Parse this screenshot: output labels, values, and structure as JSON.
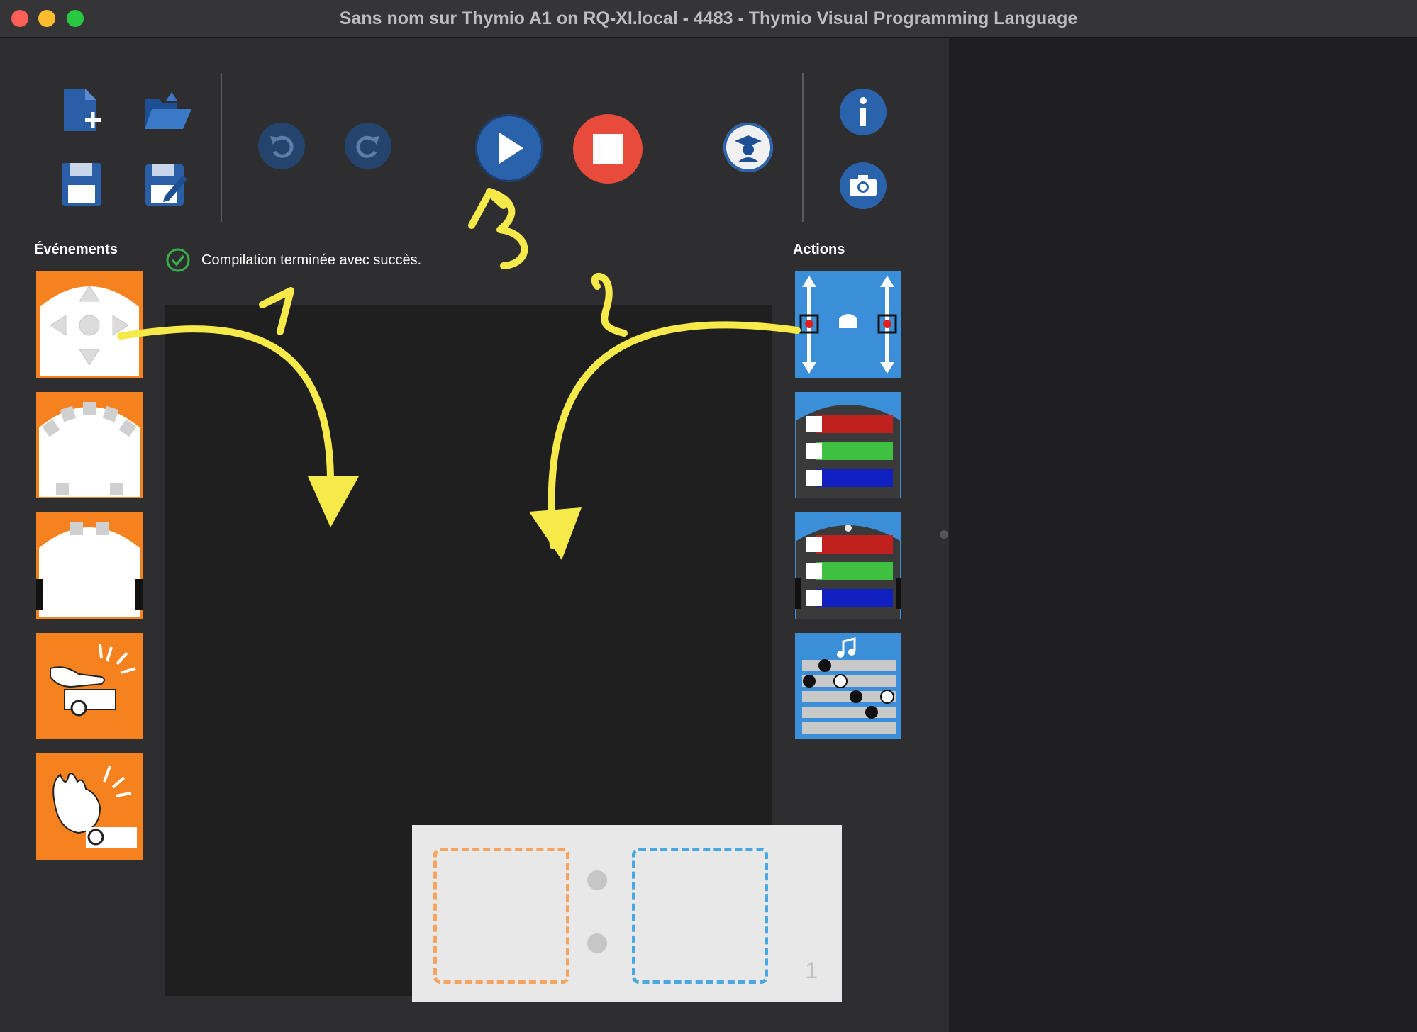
{
  "window": {
    "title": "Sans nom  sur Thymio A1 on RQ-XI.local - 4483 - Thymio Visual Programming Language"
  },
  "toolbar": {
    "new_icon": "new-file-icon",
    "open_icon": "open-folder-icon",
    "save_icon": "save-icon",
    "save_as_icon": "save-as-icon",
    "undo_icon": "undo-icon",
    "redo_icon": "redo-icon",
    "run_icon": "play-icon",
    "stop_icon": "stop-icon",
    "advanced_icon": "graduate-icon",
    "info_icon": "info-icon",
    "screenshot_icon": "camera-icon"
  },
  "events_label": "Événements",
  "actions_label": "Actions",
  "status": {
    "message": "Compilation terminée avec succès."
  },
  "event_blocks": [
    "buttons-event",
    "proximity-event",
    "ground-event",
    "tap-event",
    "clap-event"
  ],
  "action_blocks": [
    "motors-action",
    "top-color-action",
    "bottom-color-action",
    "music-action"
  ],
  "program": {
    "row_number": "1"
  },
  "annotations": {
    "step1": "1",
    "step2": "2",
    "step3": "3"
  },
  "colors": {
    "event_orange": "#f6821f",
    "action_blue": "#3a8fd8",
    "annotation_yellow": "#f6e94a",
    "play_blue": "#2a62ab",
    "stop_red": "#e84a3c"
  }
}
